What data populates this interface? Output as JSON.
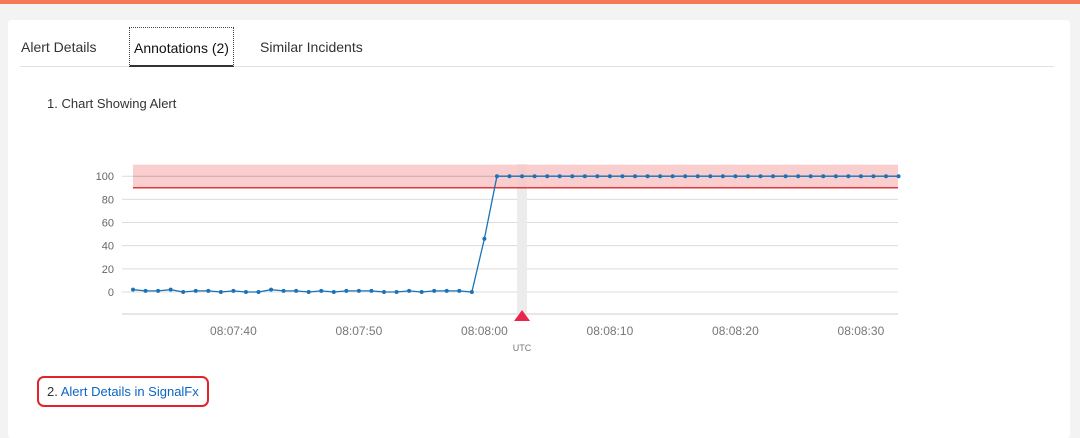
{
  "colors": {
    "accent_stripe": "#f47a5a",
    "series": "#1a73b8",
    "threshold_band": "#f9c6c6",
    "threshold_line": "#e0383e",
    "alert_marker": "#e8264d",
    "link": "#0b65c2",
    "highlight_box": "#e3232a"
  },
  "tabs": [
    {
      "label": "Alert Details",
      "active": false
    },
    {
      "label": "Annotations (2)",
      "active": true
    },
    {
      "label": "Similar Incidents",
      "active": false
    }
  ],
  "annotations": [
    {
      "number": "1.",
      "title": "Chart Showing Alert"
    },
    {
      "number": "2.",
      "title": "Alert Details in SignalFx"
    }
  ],
  "chart_data": {
    "type": "line",
    "title": "",
    "xlabel": "UTC",
    "ylabel": "",
    "ylim": [
      -20,
      110
    ],
    "y_ticks": [
      "0",
      "20",
      "40",
      "60",
      "80",
      "100"
    ],
    "x_ticks": [
      "08:07:40",
      "08:07:50",
      "08:08:00",
      "08:08:10",
      "08:08:20",
      "08:08:30"
    ],
    "x_start": "08:07:32",
    "x_step_seconds": 1,
    "grid": "horizontal",
    "threshold_band": [
      90,
      110
    ],
    "threshold_line": 90,
    "alert_marker_x": "08:08:03",
    "series": [
      {
        "values": [
          2,
          1,
          1,
          2,
          0,
          1,
          1,
          0,
          1,
          0,
          0,
          2,
          1,
          1,
          0,
          1,
          0,
          1,
          1,
          1,
          0,
          0,
          1,
          0,
          1,
          1,
          1,
          0,
          46,
          100,
          100,
          100,
          100,
          100,
          100,
          100,
          100,
          100,
          100,
          100,
          100,
          100,
          100,
          100,
          100,
          100,
          100,
          100,
          100,
          100,
          100,
          100,
          100,
          100,
          100,
          100,
          100,
          100,
          100,
          100,
          100,
          100
        ]
      }
    ]
  }
}
